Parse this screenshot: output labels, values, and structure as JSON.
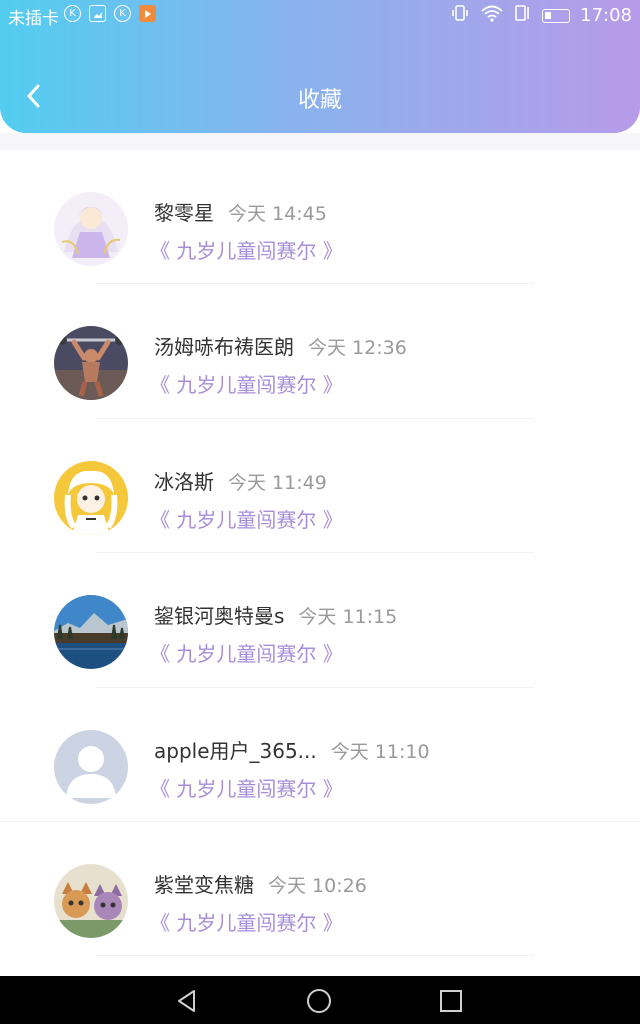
{
  "status_bar": {
    "carrier": "未插卡",
    "time": "17:08",
    "left_icons": [
      "k-circle-icon",
      "image-icon",
      "k-circle-icon",
      "play-badge-icon"
    ],
    "right_icons": [
      "vibrate-icon",
      "wifi-icon",
      "data-transfer-icon",
      "battery-icon"
    ]
  },
  "header": {
    "title": "收藏",
    "back_icon": "chevron-left-icon",
    "gradient": [
      "#52cdf0",
      "#b79be8"
    ]
  },
  "colors": {
    "accent": "#a78ed8",
    "name_text": "#333333",
    "time_text": "#9a9a9a"
  },
  "items": [
    {
      "name": "黎零星",
      "time": "今天 14:45",
      "title": "《 九岁儿童闯赛尔 》",
      "avatar": "anime-girl-avatar"
    },
    {
      "name": "汤姆哧布祷医朗",
      "time": "今天 12:36",
      "title": "《 九岁儿童闯赛尔 》",
      "avatar": "muscle-man-avatar"
    },
    {
      "name": "冰洛斯",
      "time": "今天 11:49",
      "title": "《 九岁儿童闯赛尔 》",
      "avatar": "anime-maid-avatar"
    },
    {
      "name": "鋆银河奥特曼s",
      "time": "今天 11:15",
      "title": "《 九岁儿童闯赛尔 》",
      "avatar": "landscape-avatar"
    },
    {
      "name": "apple用户_365...",
      "time": "今天 11:10",
      "title": "《 九岁儿童闯赛尔 》",
      "avatar": "default-user-avatar"
    },
    {
      "name": "紫堂变焦糖",
      "time": "今天 10:26",
      "title": "《 九岁儿童闯赛尔 》",
      "avatar": "cartoon-cats-avatar"
    }
  ],
  "nav_bar": {
    "icons": [
      "back-triangle-icon",
      "home-circle-icon",
      "recents-square-icon"
    ]
  }
}
